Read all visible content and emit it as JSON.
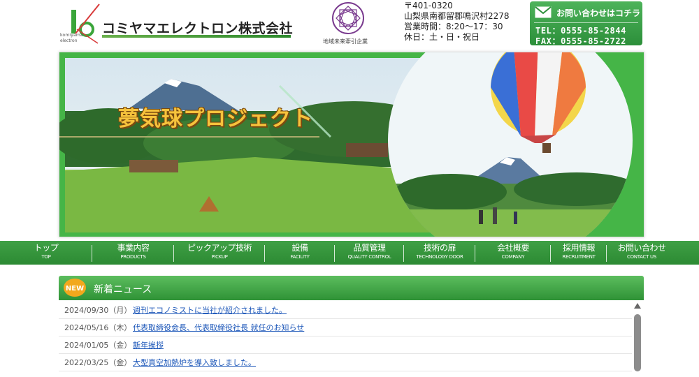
{
  "header": {
    "logo_sub1": "komiyama",
    "logo_sub2": "electron",
    "company_name": "コミヤマエレクトロン株式会社",
    "emblem_caption": "地域未来牽引企業",
    "address": {
      "postal": "〒401-0320",
      "location": "山梨県南都留郡鳴沢村2278",
      "hours": "営業時間：8:20〜17：30",
      "holidays": "休日：土・日・祝日"
    },
    "contact": {
      "label": "お問い合わせはコチラ",
      "tel": "TEL：0555-85-2844",
      "fax": "FAX：0555-85-2722",
      "icon": "mail-icon"
    }
  },
  "hero": {
    "title": "夢気球プロジェクト"
  },
  "nav": [
    {
      "jp": "トップ",
      "en": "TOP",
      "name": "nav-top",
      "width": 132
    },
    {
      "jp": "事業内容",
      "en": "PRODUCTS",
      "name": "nav-products",
      "width": 117
    },
    {
      "jp": "ピックアップ技術",
      "en": "PICKUP",
      "name": "nav-pickup",
      "width": 130
    },
    {
      "jp": "設備",
      "en": "FACILITY",
      "name": "nav-facility",
      "width": 100
    },
    {
      "jp": "品質管理",
      "en": "QUALITY CONTROL",
      "name": "nav-quality",
      "width": 99
    },
    {
      "jp": "技術の扉",
      "en": "TECHNOLOGY DOOR",
      "name": "nav-technology",
      "width": 102
    },
    {
      "jp": "会社概要",
      "en": "COMPANY",
      "name": "nav-company",
      "width": 108
    },
    {
      "jp": "採用情報",
      "en": "RECRUITMENT",
      "name": "nav-recruitment",
      "width": 80
    },
    {
      "jp": "お問い合わせ",
      "en": "CONTACT US",
      "name": "nav-contact",
      "width": 100
    }
  ],
  "news": {
    "badge": "NEW",
    "title": "新着ニュース",
    "items": [
      {
        "date": "2024/09/30（月）",
        "text": "週刊エコノミストに当社が紹介されました。"
      },
      {
        "date": "2024/05/16（木）",
        "text": "代表取締役会長、代表取締役社長 就任のお知らせ"
      },
      {
        "date": "2024/01/05（金）",
        "text": "新年挨拶"
      },
      {
        "date": "2022/03/25（金）",
        "text": "大型真空加熱炉を導入致しました。"
      }
    ]
  },
  "colors": {
    "brand_green": "#2c8a33",
    "link_blue": "#1a55b8"
  }
}
